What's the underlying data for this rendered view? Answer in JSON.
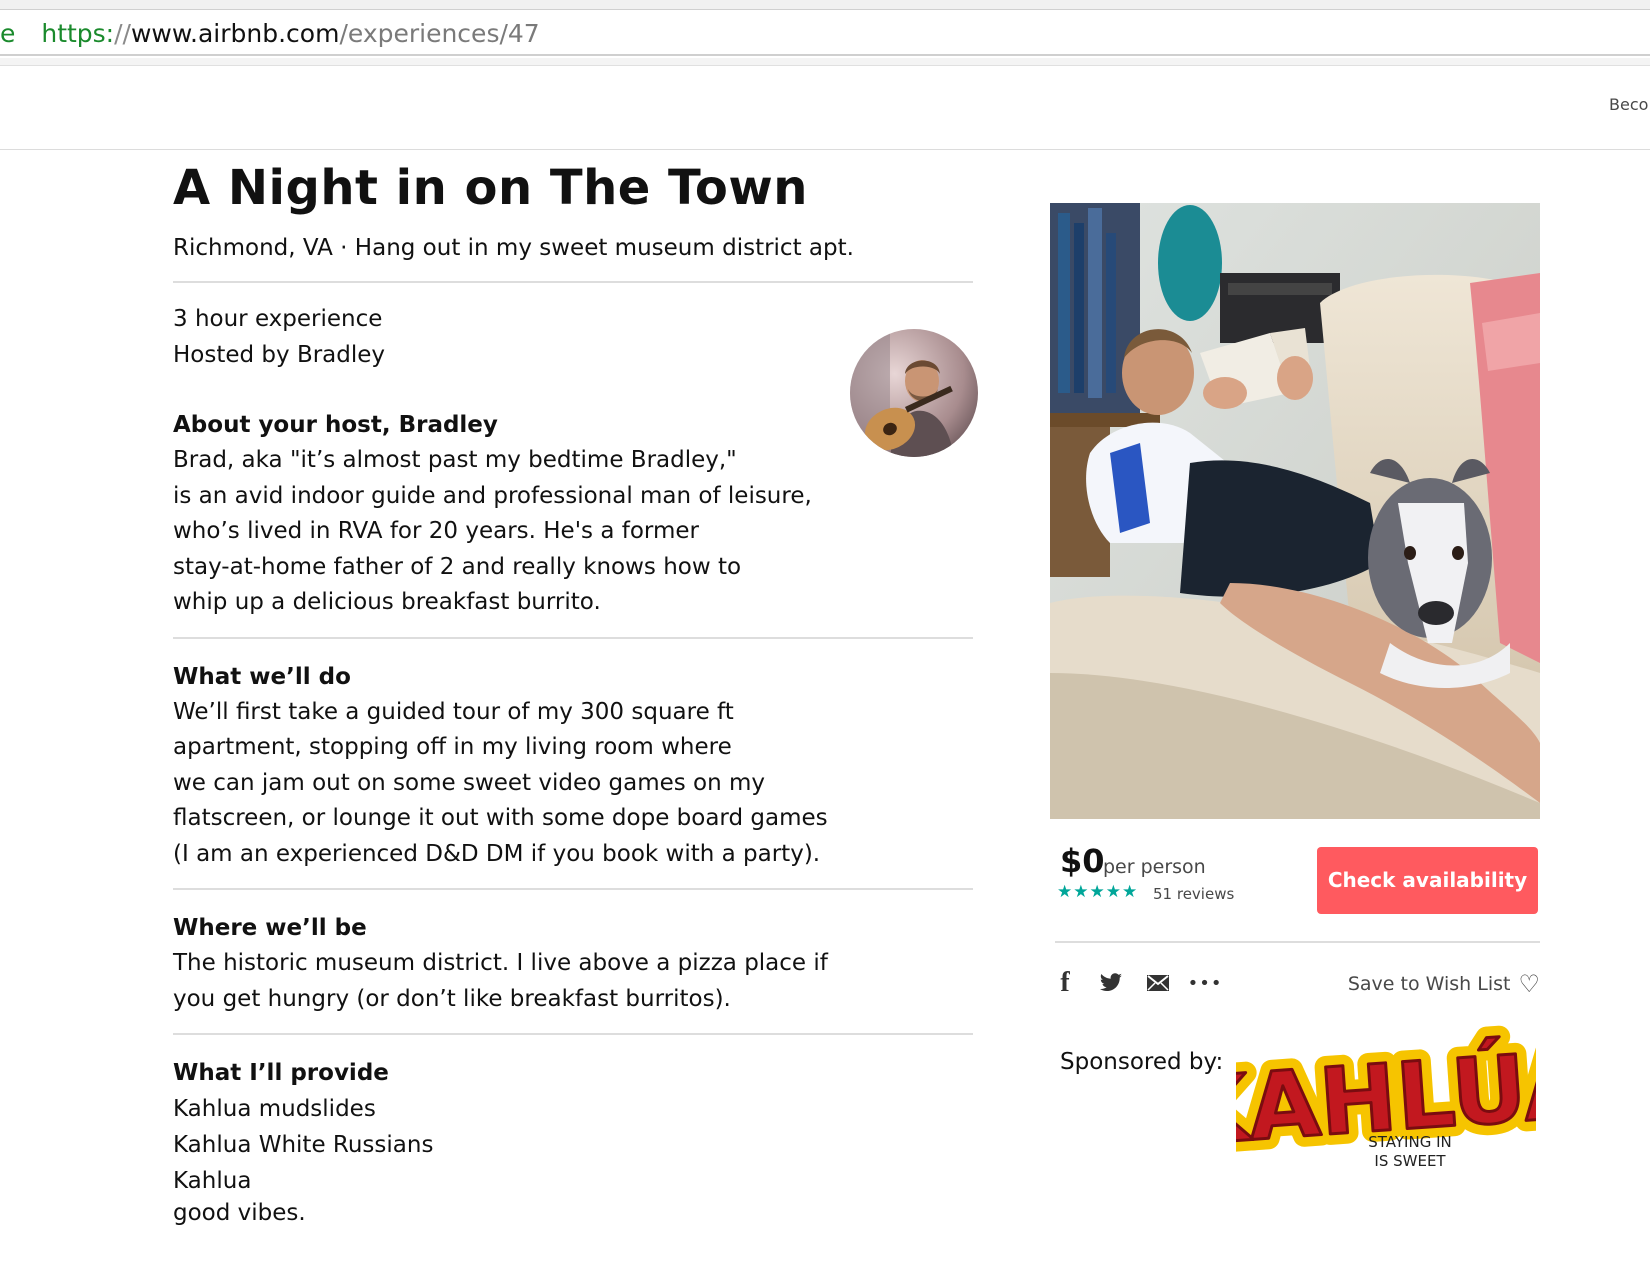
{
  "browser": {
    "url_lead": "e",
    "url_scheme": "https:",
    "url_sep": "//",
    "url_host": "www.airbnb.com",
    "url_path": "/experiences/47"
  },
  "header": {
    "become_host_label": "Beco"
  },
  "experience": {
    "title": "A Night in on The Town",
    "subtitle": "Richmond, VA · Hang out in my sweet museum district apt.",
    "duration": "3 hour experience",
    "hosted_by": "Hosted by Bradley"
  },
  "about_host": {
    "heading": "About your host, Bradley",
    "lines": [
      "Brad, aka \"it’s almost past my bedtime Bradley,\"",
      "is an avid indoor guide and professional man of leisure,",
      "who’s lived in RVA for 20 years. He's a former",
      "stay-at-home father of 2 and really knows how to",
      "whip up a delicious breakfast burrito."
    ]
  },
  "what_well_do": {
    "heading": "What we’ll do",
    "lines": [
      "We’ll first take a guided tour of my 300 square ft",
      "apartment, stopping off in my living room where",
      "we can jam out on some sweet video games on my",
      "flatscreen, or lounge it out with some dope board games",
      "(I am an experienced D&D DM if you book with a party)."
    ]
  },
  "where_well_be": {
    "heading": "Where we’ll be",
    "lines": [
      "The historic museum district.  I live above a pizza place if",
      "you get hungry (or don’t like breakfast burritos)."
    ]
  },
  "what_ill_provide": {
    "heading": "What I’ll provide",
    "items": [
      "Kahlua mudslides",
      "Kahlua White Russians",
      "Kahlua",
      "good vibes."
    ]
  },
  "booking": {
    "price": "$0",
    "per_person": "per person",
    "stars": "★★★★★",
    "rating": 5,
    "reviews": "51 reviews",
    "check_availability_label": "Check availability",
    "accent_color": "#ff5a5f",
    "star_color": "#00a699"
  },
  "share": {
    "icons": [
      "facebook-icon",
      "twitter-icon",
      "email-icon",
      "more-icon"
    ],
    "facebook_glyph": "f",
    "more_glyph": "•••",
    "save_label": "Save to Wish List",
    "heart_glyph": "♡"
  },
  "sponsor": {
    "label": "Sponsored by:",
    "brand": "KAHLÚA",
    "tagline_1": "STAYING IN",
    "tagline_2": "IS SWEET"
  }
}
